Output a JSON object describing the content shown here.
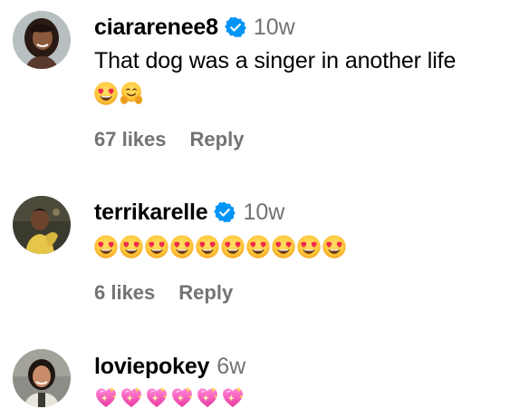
{
  "colors": {
    "username": "#000000",
    "meta": "#737373",
    "verified": "#0095F6",
    "background": "#ffffff"
  },
  "comments": [
    {
      "username": "ciararenee8",
      "verified": true,
      "time": "10w",
      "text": "That dog was a singer in another life",
      "emojis": [
        "heart-eyes",
        "hugging-face"
      ],
      "likes": "67 likes",
      "reply": "Reply"
    },
    {
      "username": "terrikarelle",
      "verified": true,
      "time": "10w",
      "text": "",
      "emojis": [
        "heart-eyes",
        "heart-eyes",
        "heart-eyes",
        "heart-eyes",
        "heart-eyes",
        "heart-eyes",
        "heart-eyes",
        "heart-eyes",
        "heart-eyes",
        "heart-eyes"
      ],
      "likes": "6 likes",
      "reply": "Reply"
    },
    {
      "username": "loviepokey",
      "verified": false,
      "time": "6w",
      "text": "",
      "emojis": [
        "sparkling-heart",
        "sparkling-heart",
        "sparkling-heart",
        "sparkling-heart",
        "sparkling-heart",
        "sparkling-heart"
      ]
    }
  ]
}
